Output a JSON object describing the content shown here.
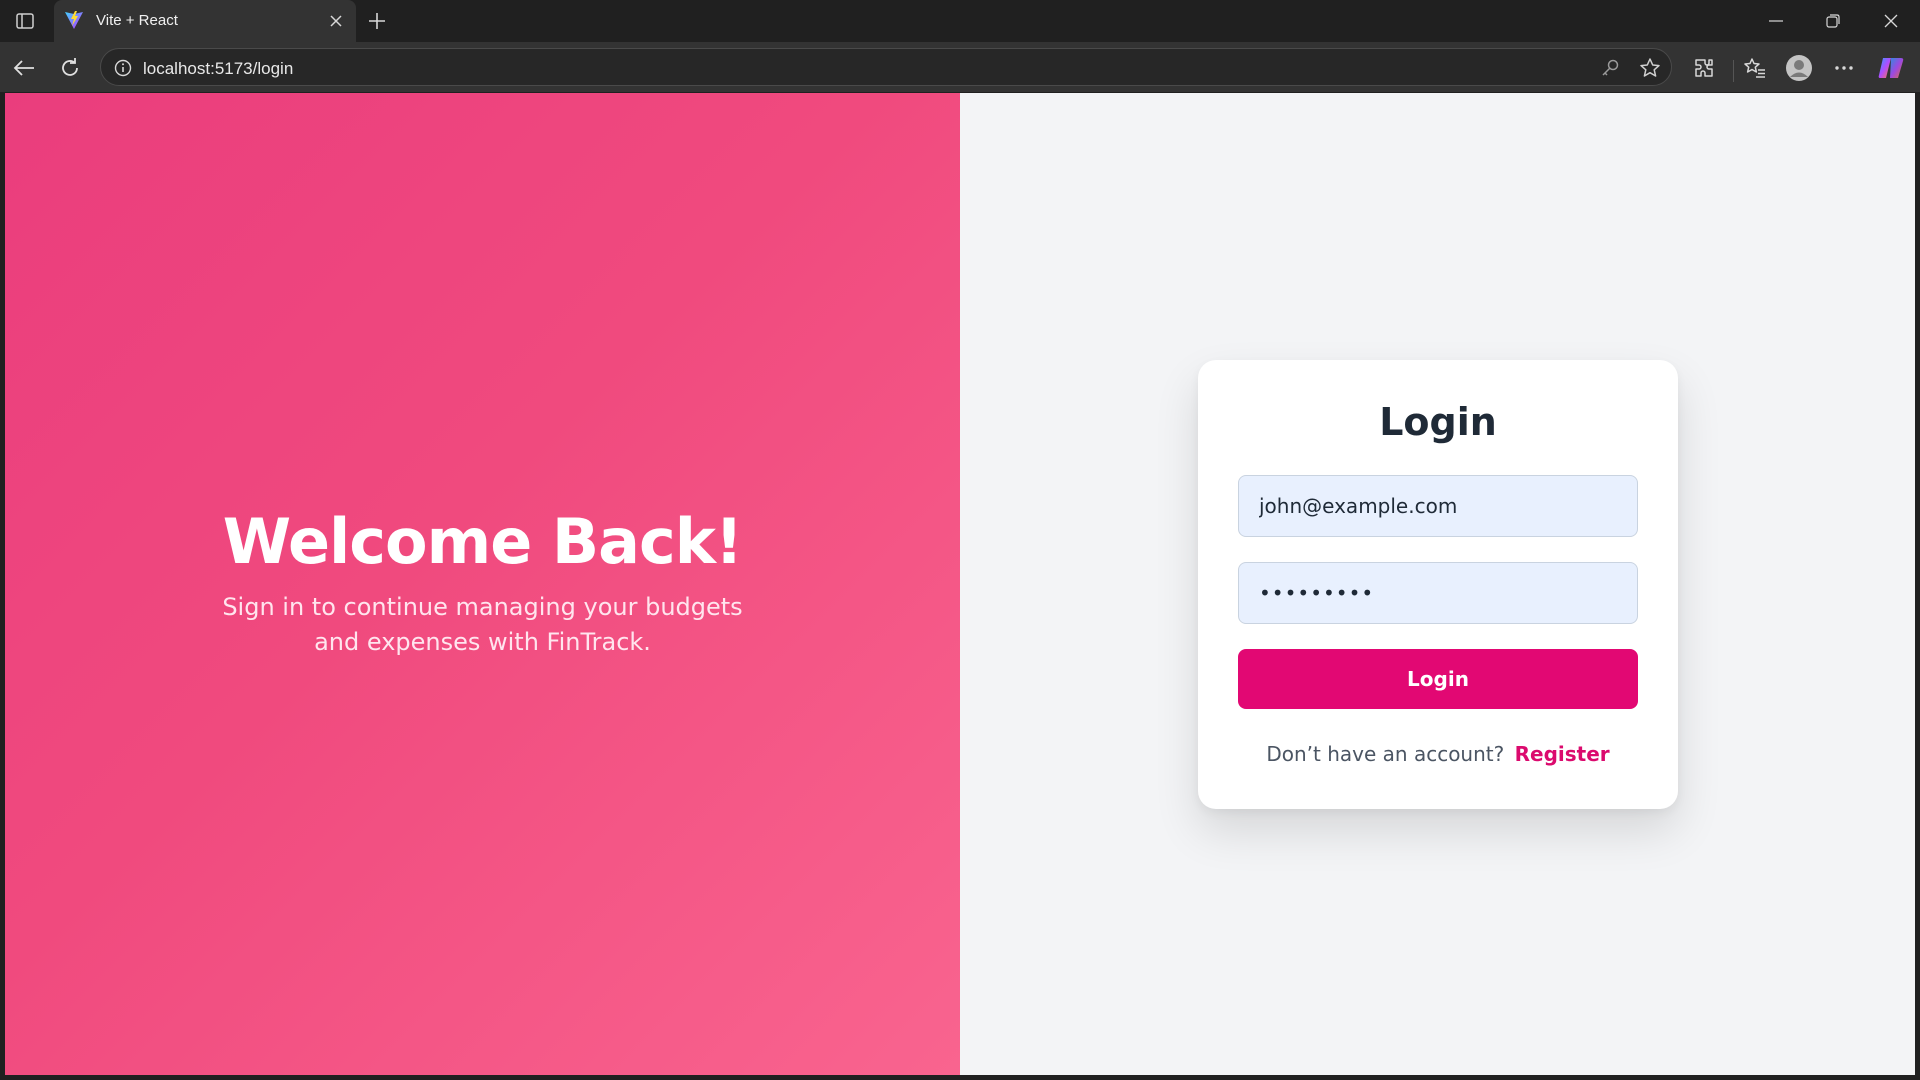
{
  "browser": {
    "tab": {
      "title": "Vite + React"
    },
    "address": {
      "url": "localhost:5173/login"
    }
  },
  "hero": {
    "title": "Welcome Back!",
    "subtitle": "Sign in to continue managing your budgets and expenses with FinTrack."
  },
  "login_card": {
    "title": "Login",
    "email": {
      "value": "john@example.com"
    },
    "password": {
      "value": "•••••••••"
    },
    "submit_label": "Login",
    "register_prompt": "Don’t have an account?",
    "register_link": "Register"
  },
  "colors": {
    "accent": "#e20873",
    "hero_gradient_start": "#ea3d7d",
    "hero_gradient_end": "#f9648f",
    "input_bg": "#e8f0fe"
  }
}
